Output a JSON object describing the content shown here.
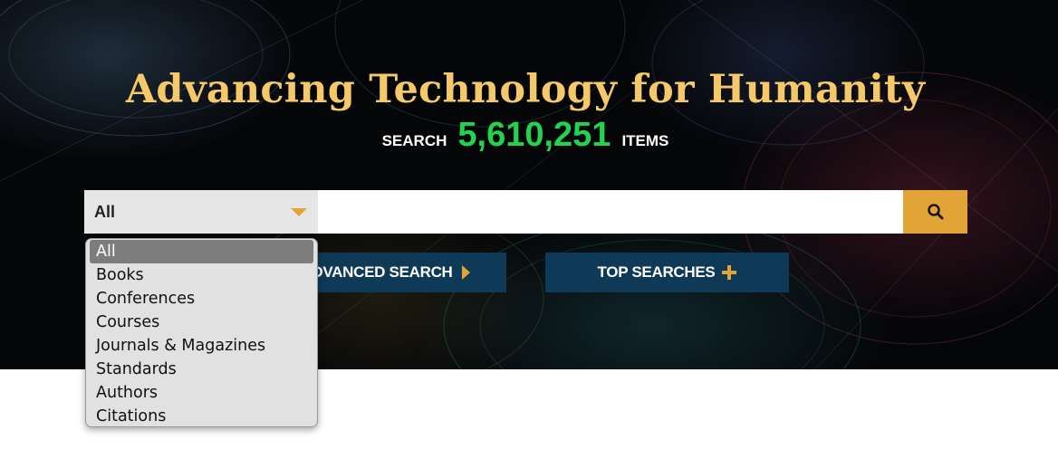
{
  "hero": {
    "headline": "Advancing Technology for Humanity",
    "counter_prefix": "SEARCH",
    "counter_value": "5,610,251",
    "counter_suffix": "ITEMS"
  },
  "search": {
    "scope_selected": "All",
    "input_value": "",
    "button_icon": "search-icon"
  },
  "dropdown": {
    "options": [
      "All",
      "Books",
      "Conferences",
      "Courses",
      "Journals & Magazines",
      "Standards",
      "Authors",
      "Citations"
    ],
    "selected_index": 0
  },
  "actions": {
    "advanced_search_label": "ADVANCED SEARCH",
    "advanced_search_icon": "chevron-right-icon",
    "top_searches_label": "TOP SEARCHES",
    "top_searches_icon": "plus-icon"
  },
  "colors": {
    "headline": "#f5c96a",
    "counter": "#21d34f",
    "accent": "#e3a437",
    "button_bg": "#0f3a57"
  }
}
